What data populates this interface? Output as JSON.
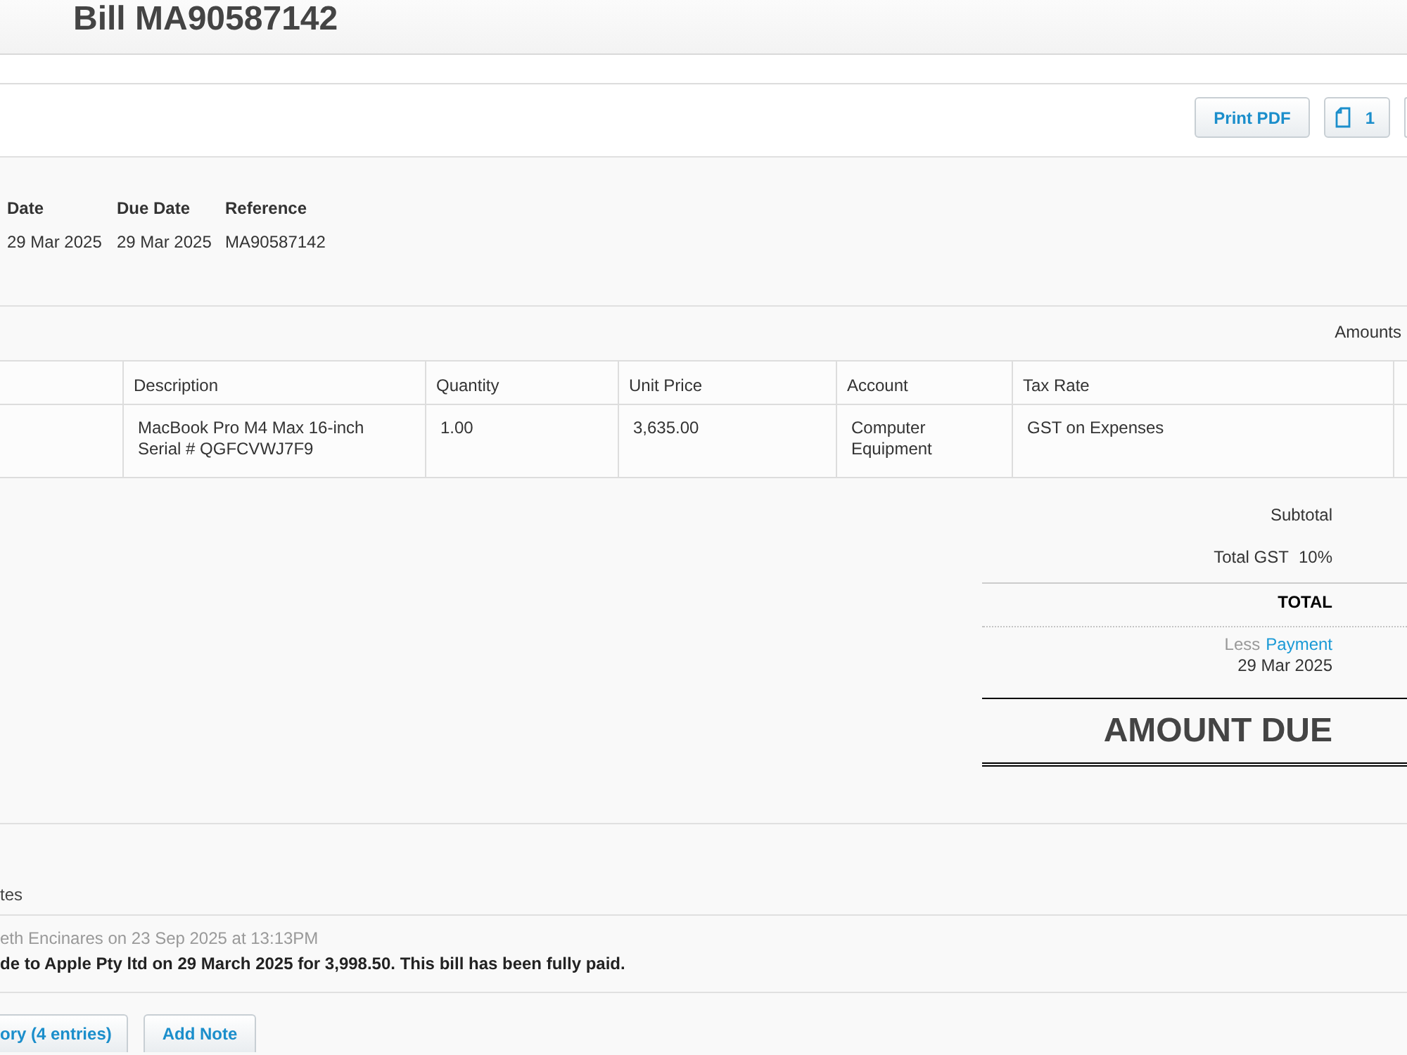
{
  "header": {
    "title": "Bill MA90587142"
  },
  "toolbar": {
    "buttons": [
      {
        "kind": "text",
        "label": "Print PDF"
      },
      {
        "kind": "attachments",
        "label": "1"
      },
      {
        "kind": "cut_off"
      }
    ]
  },
  "details": [
    {
      "label": "Date",
      "value": "29 Mar 2025"
    },
    {
      "label": "Due Date",
      "value": "29 Mar 2025"
    },
    {
      "label": "Reference",
      "value": "MA90587142"
    }
  ],
  "amounts_note": "Amounts",
  "line_items": {
    "columns": [
      "Description",
      "Quantity",
      "Unit Price",
      "Account",
      "Tax Rate"
    ],
    "rows": [
      {
        "cells": [
          "MacBook Pro M4 Max 16-inch\nSerial # QGFCVWJ7F9",
          "1.00",
          "3,635.00",
          "Computer Equipment",
          "GST on Expenses"
        ]
      }
    ]
  },
  "totals": {
    "subtotal_label": "Subtotal",
    "gst_label": "Total GST",
    "gst_rate": "10%",
    "total_label": "TOTAL",
    "payment": {
      "prefix": "Less",
      "link": "Payment",
      "date": "29 Mar 2025"
    },
    "amount_due_label": "AMOUNT DUE"
  },
  "notes": {
    "heading": "tes",
    "entries": [
      {
        "meta": "eth Encinares on 23 Sep 2025 at 13:13PM",
        "text": "de to Apple Pty ltd on 29 March 2025 for 3,998.50. This bill has been fully paid."
      }
    ]
  },
  "buttons": [
    "ory (4 entries)",
    "Add Note"
  ]
}
